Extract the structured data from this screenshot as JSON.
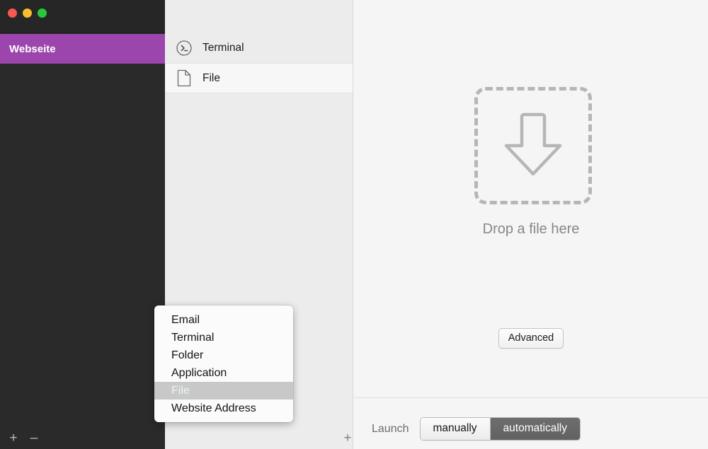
{
  "window": {
    "traffic_lights": [
      {
        "name": "close",
        "color": "#f9574f"
      },
      {
        "name": "minimize",
        "color": "#f7bd2e"
      },
      {
        "name": "maximize",
        "color": "#28c83c"
      }
    ]
  },
  "sidebar": {
    "items": [
      {
        "label": "Webseite",
        "selected": true
      }
    ],
    "footer": {
      "add_label": "+",
      "remove_label": "–"
    },
    "accent_color": "#9c46ad",
    "background_color": "#2a2a2a"
  },
  "middle_column": {
    "items": [
      {
        "label": "Terminal",
        "icon": "terminal-icon",
        "selected": false
      },
      {
        "label": "File",
        "icon": "file-icon",
        "selected": true
      }
    ],
    "footer": {
      "add_label": "+",
      "remove_label": "–"
    }
  },
  "detail": {
    "dropzone": {
      "icon": "download-arrow-icon",
      "caption": "Drop a file here"
    },
    "advanced_button": "Advanced",
    "launch": {
      "label": "Launch",
      "options": [
        {
          "label": "manually",
          "selected": false
        },
        {
          "label": "automatically",
          "selected": true
        }
      ]
    }
  },
  "popup_menu": {
    "items": [
      {
        "label": "Email",
        "highlighted": false
      },
      {
        "label": "Terminal",
        "highlighted": false
      },
      {
        "label": "Folder",
        "highlighted": false
      },
      {
        "label": "Application",
        "highlighted": false
      },
      {
        "label": "File",
        "highlighted": true
      },
      {
        "label": "Website Address",
        "highlighted": false
      }
    ]
  }
}
